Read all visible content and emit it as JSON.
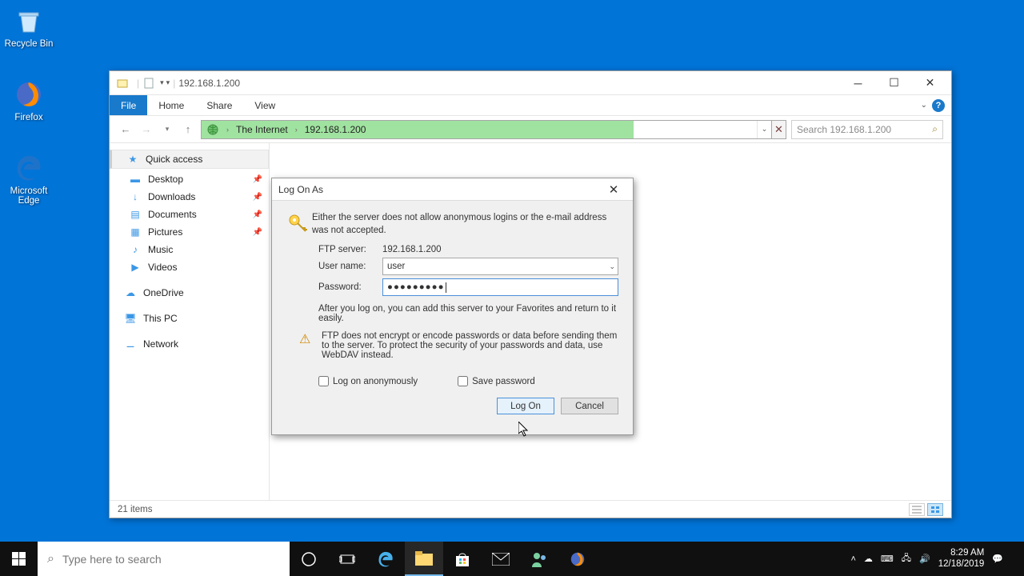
{
  "desktop": {
    "icons": [
      {
        "name": "Recycle Bin"
      },
      {
        "name": "Firefox"
      },
      {
        "name": "Microsoft Edge"
      }
    ]
  },
  "explorer": {
    "title": "192.168.1.200",
    "ribbon": {
      "file": "File",
      "home": "Home",
      "share": "Share",
      "view": "View"
    },
    "breadcrumb": {
      "root": "The Internet",
      "loc": "192.168.1.200"
    },
    "search_placeholder": "Search 192.168.1.200",
    "sidebar": {
      "quick": "Quick access",
      "items": [
        {
          "label": "Desktop",
          "pin": true
        },
        {
          "label": "Downloads",
          "pin": true
        },
        {
          "label": "Documents",
          "pin": true
        },
        {
          "label": "Pictures",
          "pin": true
        },
        {
          "label": "Music",
          "pin": false
        },
        {
          "label": "Videos",
          "pin": false
        }
      ],
      "onedrive": "OneDrive",
      "thispc": "This PC",
      "network": "Network"
    },
    "status": "21 items"
  },
  "dialog": {
    "title": "Log On As",
    "message": "Either the server does not allow anonymous logins or the e-mail address was not accepted.",
    "server_label": "FTP server:",
    "server_value": "192.168.1.200",
    "user_label": "User name:",
    "user_value": "user",
    "pass_label": "Password:",
    "pass_value": "●●●●●●●●●",
    "note": "After you log on, you can add this server to your Favorites and return to it easily.",
    "warning": "FTP does not encrypt or encode passwords or data before sending them to the server.  To protect the security of your passwords and data, use WebDAV instead.",
    "anon": "Log on anonymously",
    "save": "Save password",
    "logon": "Log On",
    "cancel": "Cancel"
  },
  "taskbar": {
    "search_placeholder": "Type here to search",
    "time": "8:29 AM",
    "date": "12/18/2019"
  }
}
